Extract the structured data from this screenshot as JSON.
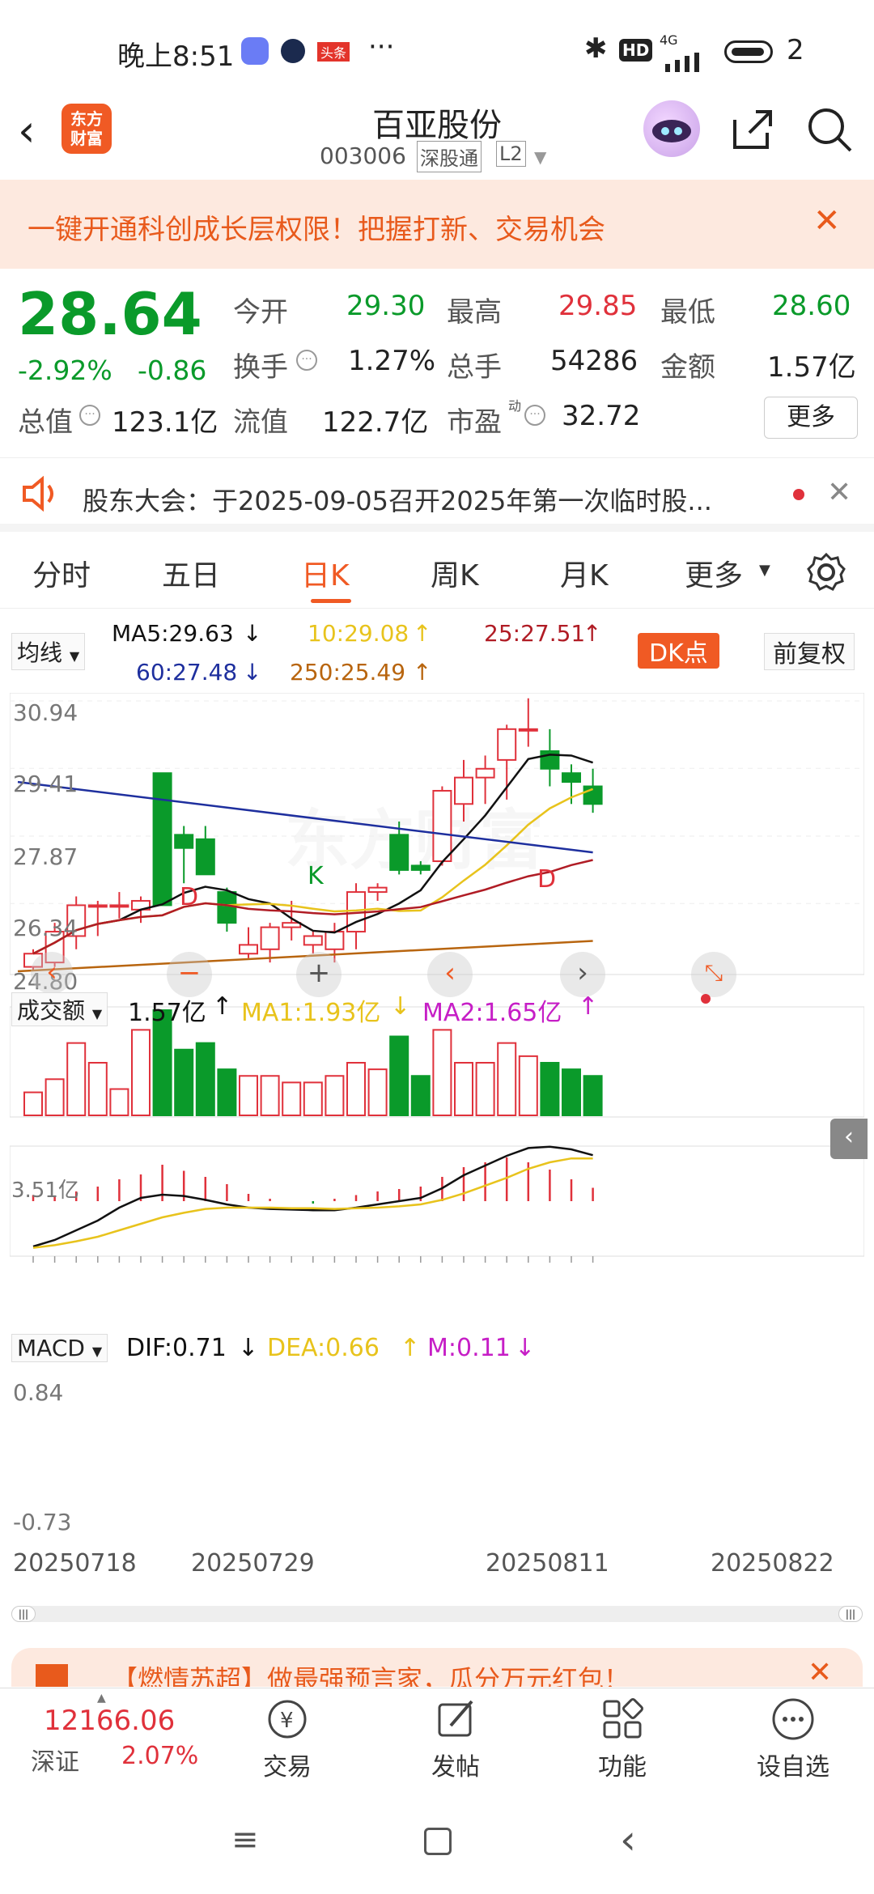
{
  "status": {
    "time": "晚上8:51",
    "dots": "···",
    "network": "4G",
    "battery": "2"
  },
  "header": {
    "name": "百亚股份",
    "code": "003006",
    "exchange": "深股通",
    "level": "L2",
    "logo": "东方\n财富"
  },
  "banner": {
    "text": "一键开通科创成长层权限！把握打新、交易机会"
  },
  "quote": {
    "price": "28.64",
    "pct": "-2.92%",
    "chg": "-0.86",
    "open_l": "今开",
    "open": "29.30",
    "high_l": "最高",
    "high": "29.85",
    "low_l": "最低",
    "low": "28.60",
    "turn_l": "换手",
    "turn": "1.27%",
    "vol_l": "总手",
    "vol": "54286",
    "amt_l": "金额",
    "amt": "1.57亿",
    "mcap_l": "总值",
    "mcap": "123.1亿",
    "float_l": "流值",
    "float": "122.7亿",
    "pe_l": "市盈",
    "pe_sup": "动",
    "pe": "32.72",
    "more": "更多"
  },
  "notice": {
    "text": "股东大会：于2025-09-05召开2025年第一次临时股..."
  },
  "tabs": [
    "分时",
    "五日",
    "日K",
    "周K",
    "月K",
    "更多"
  ],
  "ma": {
    "sel": "均线",
    "ma5": "MA5:29.63",
    "ma10": "10:29.08",
    "ma25": "25:27.51",
    "ma60": "60:27.48",
    "ma250": "250:25.49",
    "dk": "DK点",
    "adj": "前复权"
  },
  "colors": {
    "up": "#e0313b",
    "down": "#0a9a2a",
    "ma5": "#111111",
    "ma10": "#e8c31c",
    "ma25": "#b01c25",
    "ma60": "#1e2f9e",
    "ma250": "#b8650f",
    "accent": "#ff6a1c"
  },
  "yaxis": [
    "30.94",
    "29.41",
    "27.87",
    "26.34",
    "24.80"
  ],
  "watermark": "东方财富",
  "vol": {
    "sel": "成交额",
    "val": "1.57亿",
    "ma1": "MA1:1.93亿",
    "ma2": "MA2:1.65亿",
    "max": "3.51亿"
  },
  "macd": {
    "sel": "MACD",
    "dif": "DIF:0.71",
    "dea": "DEA:0.66",
    "m": "M:0.11",
    "top": "0.84",
    "bot": "-0.73"
  },
  "dates": [
    "20250718",
    "20250729",
    "20250811",
    "20250822"
  ],
  "promo": {
    "text": "【燃情苏超】做最强预言家，瓜分万元红包！"
  },
  "nav": {
    "index": "12166.06",
    "index_name": "深证",
    "index_pct": "2.07%",
    "trade": "交易",
    "post": "发帖",
    "func": "功能",
    "watch": "设自选"
  },
  "chart_data": {
    "type": "candlestick",
    "ylim": [
      24.8,
      30.94
    ],
    "candles": [
      {
        "o": 24.9,
        "h": 25.3,
        "l": 24.8,
        "c": 25.2
      },
      {
        "o": 25.0,
        "h": 25.9,
        "l": 24.9,
        "c": 25.7
      },
      {
        "o": 25.6,
        "h": 26.5,
        "l": 25.3,
        "c": 26.3
      },
      {
        "o": 26.3,
        "h": 26.4,
        "l": 25.6,
        "c": 26.3
      },
      {
        "o": 26.3,
        "h": 26.6,
        "l": 26.0,
        "c": 26.3
      },
      {
        "o": 26.2,
        "h": 26.5,
        "l": 25.9,
        "c": 26.4
      },
      {
        "o": 29.3,
        "h": 29.3,
        "l": 26.3,
        "c": 26.3
      },
      {
        "o": 27.9,
        "h": 28.1,
        "l": 26.8,
        "c": 27.6
      },
      {
        "o": 27.8,
        "h": 28.1,
        "l": 27.0,
        "c": 27.0
      },
      {
        "o": 26.6,
        "h": 26.7,
        "l": 25.7,
        "c": 25.9
      },
      {
        "o": 25.2,
        "h": 25.8,
        "l": 25.1,
        "c": 25.4
      },
      {
        "o": 25.3,
        "h": 25.9,
        "l": 25.0,
        "c": 25.8
      },
      {
        "o": 25.8,
        "h": 26.4,
        "l": 25.5,
        "c": 25.9
      },
      {
        "o": 25.4,
        "h": 25.7,
        "l": 25.2,
        "c": 25.6
      },
      {
        "o": 25.3,
        "h": 25.9,
        "l": 25.0,
        "c": 25.7
      },
      {
        "o": 25.7,
        "h": 26.8,
        "l": 25.3,
        "c": 26.6
      },
      {
        "o": 26.6,
        "h": 26.8,
        "l": 26.4,
        "c": 26.7
      },
      {
        "o": 27.9,
        "h": 28.2,
        "l": 27.0,
        "c": 27.1
      },
      {
        "o": 27.2,
        "h": 27.3,
        "l": 27.0,
        "c": 27.1
      },
      {
        "o": 27.3,
        "h": 29.0,
        "l": 27.2,
        "c": 28.9
      },
      {
        "o": 28.6,
        "h": 29.6,
        "l": 28.2,
        "c": 29.2
      },
      {
        "o": 29.2,
        "h": 29.7,
        "l": 28.6,
        "c": 29.4
      },
      {
        "o": 29.6,
        "h": 30.4,
        "l": 28.7,
        "c": 30.3
      },
      {
        "o": 30.3,
        "h": 31.0,
        "l": 29.9,
        "c": 30.3
      },
      {
        "o": 29.8,
        "h": 30.3,
        "l": 29.0,
        "c": 29.4
      },
      {
        "o": 29.3,
        "h": 29.5,
        "l": 28.6,
        "c": 29.1
      },
      {
        "o": 29.0,
        "h": 29.4,
        "l": 28.4,
        "c": 28.6
      }
    ]
  }
}
